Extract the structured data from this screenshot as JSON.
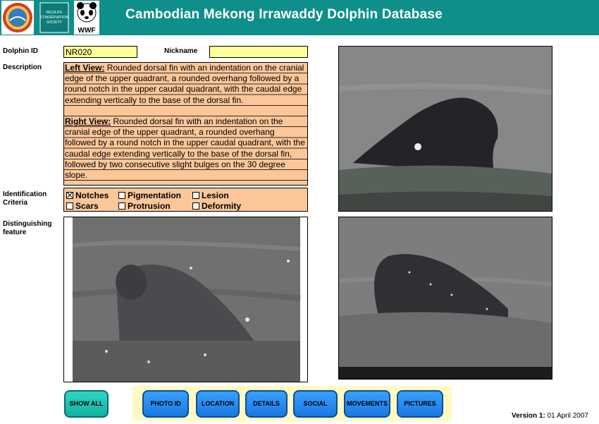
{
  "header": {
    "title": "Cambodian Mekong Irrawaddy Dolphin Database",
    "logos": [
      "fisheries-emblem",
      "wildlife-conservation-society-logo",
      "wwf-panda-logo"
    ],
    "wcs_logo_text": "WILDLIFE CONSERVATION SOCIETY",
    "wwf_logo_text": "WWF"
  },
  "form": {
    "dolphin_id_label": "Dolphin ID",
    "dolphin_id_value": "NR020",
    "nickname_label": "Nickname",
    "nickname_value": "",
    "description_label": "Description",
    "left_view_heading": "Left View:",
    "left_view_text": " Rounded dorsal fin with an indentation on the cranial edge of the upper quadrant, a rounded overhang followed by a round notch in the upper caudal quadrant, with the caudal edge extending vertically to the base of the dorsal fin.",
    "right_view_heading": "Right View:",
    "right_view_text": " Rounded dorsal fin with an indentation on the cranial edge of the upper quadrant, a rounded overhang followed by a round notch in the upper caudal quadrant, with the caudal edge extending vertically to the base of the dorsal fin, followed by two consecutive slight bulges on the 30 degree slope.",
    "criteria_label_1": "Identification",
    "criteria_label_2": "Criteria",
    "criteria": [
      {
        "label": "Notches",
        "checked": true
      },
      {
        "label": "Pigmentation",
        "checked": false
      },
      {
        "label": "Lesion",
        "checked": false
      },
      {
        "label": "Scars",
        "checked": false
      },
      {
        "label": "Protrusion",
        "checked": false
      },
      {
        "label": "Deformity",
        "checked": false
      }
    ],
    "feature_label_1": "Distinguishing",
    "feature_label_2": "feature"
  },
  "buttons": {
    "show_all": "SHOW ALL",
    "photo_id": "PHOTO ID",
    "location": "LOCATION",
    "details": "DETAILS",
    "social": "SOCIAL",
    "movements": "MOVEMENTS",
    "pictures": "PICTURES"
  },
  "footer": {
    "version_label": "Version 1:",
    "version_date": " 01 April 2007"
  },
  "colors": {
    "header": "#0f8f8a",
    "field_yellow": "#ffff99",
    "description_orange": "#fbc79a",
    "button_blue": "#1a78e0",
    "button_teal": "#12b0a4"
  }
}
